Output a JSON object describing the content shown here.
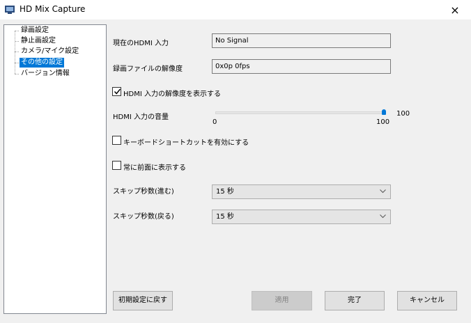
{
  "window": {
    "title": "HD Mix Capture",
    "close_icon": "×"
  },
  "tree": {
    "items": [
      {
        "label": "録画設定",
        "selected": false
      },
      {
        "label": "静止画設定",
        "selected": false
      },
      {
        "label": "カメラ/マイク設定",
        "selected": false
      },
      {
        "label": "その他の設定",
        "selected": true
      },
      {
        "label": "バージョン情報",
        "selected": false
      }
    ]
  },
  "settings": {
    "hdmi_input_label": "現在のHDMI 入力",
    "hdmi_input_value": "No Signal",
    "resolution_label": "録画ファイルの解像度",
    "resolution_value": "0x0p 0fps",
    "show_resolution_label": "HDMI 入力の解像度を表示する",
    "show_resolution_checked": true,
    "volume_label": "HDMI 入力の音量",
    "volume_value": "100",
    "volume_min": "0",
    "volume_max": "100",
    "volume_level": 1.0,
    "shortcut_label": "キーボードショートカットを有効にする",
    "shortcut_checked": false,
    "topmost_label": "常に前面に表示する",
    "topmost_checked": false,
    "skip_forward_label": "スキップ秒数(進む)",
    "skip_forward_value": "15 秒",
    "skip_back_label": "スキップ秒数(戻る)",
    "skip_back_value": "15 秒"
  },
  "buttons": {
    "reset": "初期設定に戻す",
    "apply": "適用",
    "done": "完了",
    "cancel": "キャンセル"
  }
}
